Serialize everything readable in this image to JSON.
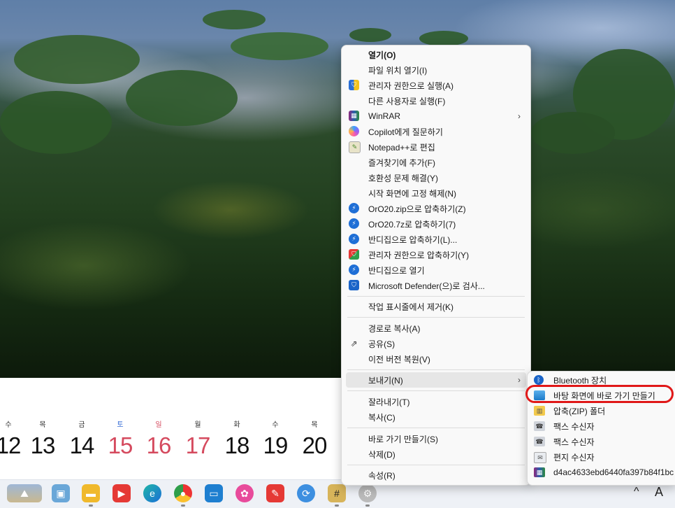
{
  "context_menu": {
    "items": [
      {
        "label": "열기(O)",
        "icon": "none",
        "bold": true
      },
      {
        "label": "파일 위치 열기(I)",
        "icon": "none"
      },
      {
        "label": "관리자 권한으로 실행(A)",
        "icon": "uac-shield-icon"
      },
      {
        "label": "다른 사용자로 실행(F)",
        "icon": "none"
      },
      {
        "label": "WinRAR",
        "icon": "winrar-icon",
        "submenu": true
      },
      {
        "label": "Copilot에게 질문하기",
        "icon": "copilot-icon"
      },
      {
        "label": "Notepad++로 편집",
        "icon": "notepadpp-icon"
      },
      {
        "label": "즐겨찾기에 추가(F)",
        "icon": "none"
      },
      {
        "label": "호환성 문제 해결(Y)",
        "icon": "none"
      },
      {
        "label": "시작 화면에 고정 해제(N)",
        "icon": "none"
      },
      {
        "label": "OrO20.zip으로 압축하기(Z)",
        "icon": "bandizip-icon"
      },
      {
        "label": "OrO20.7z로 압축하기(7)",
        "icon": "bandizip-icon"
      },
      {
        "label": "반디집으로 압축하기(L)...",
        "icon": "bandizip-icon"
      },
      {
        "label": "관리자 권한으로 압축하기(Y)",
        "icon": "bandizip-shield-icon"
      },
      {
        "label": "반디집으로 열기",
        "icon": "bandizip-icon"
      },
      {
        "label": "Microsoft Defender(으)로 검사...",
        "icon": "defender-icon"
      },
      {
        "label": "작업 표시줄에서 제거(K)",
        "icon": "none"
      },
      {
        "label": "경로로 복사(A)",
        "icon": "none"
      },
      {
        "label": "공유(S)",
        "icon": "share-icon"
      },
      {
        "label": "이전 버전 복원(V)",
        "icon": "none"
      },
      {
        "label": "보내기(N)",
        "icon": "none",
        "submenu": true
      },
      {
        "label": "잘라내기(T)",
        "icon": "none"
      },
      {
        "label": "복사(C)",
        "icon": "none"
      },
      {
        "label": "바로 가기 만들기(S)",
        "icon": "none"
      },
      {
        "label": "삭제(D)",
        "icon": "none"
      },
      {
        "label": "속성(R)",
        "icon": "none"
      }
    ]
  },
  "send_to_submenu": {
    "items": [
      {
        "label": "Bluetooth 장치",
        "icon": "bluetooth-icon"
      },
      {
        "label": "바탕 화면에 바로 가기 만들기",
        "icon": "desktop-icon"
      },
      {
        "label": "압축(ZIP) 폴더",
        "icon": "zip-folder-icon"
      },
      {
        "label": "팩스 수신자",
        "icon": "fax-icon"
      },
      {
        "label": "팩스 수신자",
        "icon": "fax-icon"
      },
      {
        "label": "편지 수신자",
        "icon": "mail-icon"
      },
      {
        "label": "d4ac4633ebd6440fa397b84f1bc",
        "icon": "winrar-icon"
      }
    ]
  },
  "calendar": {
    "days": [
      {
        "dow": "수",
        "num": "12"
      },
      {
        "dow": "목",
        "num": "13"
      },
      {
        "dow": "금",
        "num": "14"
      },
      {
        "dow": "토",
        "num": "15"
      },
      {
        "dow": "일",
        "num": "16"
      },
      {
        "dow": "월",
        "num": "17"
      },
      {
        "dow": "화",
        "num": "18"
      },
      {
        "dow": "수",
        "num": "19"
      },
      {
        "dow": "목",
        "num": "20"
      }
    ]
  },
  "tray": {
    "caret": "^",
    "ime": "A"
  },
  "taskbar_icons": [
    "landscape-widget-icon",
    "computer-icon",
    "file-explorer-icon",
    "youtube-music-icon",
    "edge-icon",
    "chrome-icon",
    "monitor-app-icon",
    "photos-app-icon",
    "notes-app-icon",
    "sync-app-icon",
    "baduk-game-icon",
    "tool-app-icon"
  ]
}
